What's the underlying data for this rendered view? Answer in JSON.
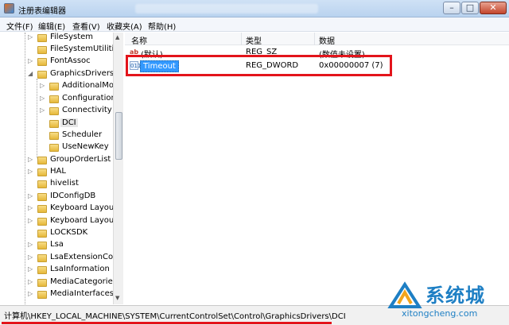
{
  "window": {
    "title": "注册表编辑器",
    "controls": {
      "minimize": "–",
      "maximize": "□",
      "close": "✕"
    }
  },
  "menu": [
    "文件(F)",
    "编辑(E)",
    "查看(V)",
    "收藏夹(A)",
    "帮助(H)"
  ],
  "tree": {
    "items": [
      "FileSystem",
      "FileSystemUtilities",
      "FontAssoc",
      "GraphicsDrivers",
      "AdditionalModes",
      "Configuration",
      "Connectivity",
      "DCI",
      "Scheduler",
      "UseNewKey",
      "GroupOrderList",
      "HAL",
      "hivelist",
      "IDConfigDB",
      "Keyboard Layout",
      "Keyboard Layouts",
      "LOCKSDK",
      "Lsa",
      "LsaExtensionConfig",
      "LsaInformation",
      "MediaCategories",
      "MediaInterfaces"
    ],
    "selected": "DCI"
  },
  "list": {
    "columns": [
      "名称",
      "类型",
      "数据"
    ],
    "rows": [
      {
        "name": "(默认)",
        "type": "REG_SZ",
        "data": "(数值未设置)",
        "icon": "string-value-icon"
      },
      {
        "name": "Timeout",
        "type": "REG_DWORD",
        "data": "0x00000007 (7)",
        "icon": "binary-value-icon",
        "selected": true
      }
    ]
  },
  "status": {
    "path": "计算机\\HKEY_LOCAL_MACHINE\\SYSTEM\\CurrentControlSet\\Control\\GraphicsDrivers\\DCI"
  },
  "watermark": {
    "cn": "系统城",
    "en": "xitongcheng.com"
  },
  "colors": {
    "highlight": "#e3141b",
    "selection": "#3399ff",
    "watermark": "#1e7fc4"
  }
}
